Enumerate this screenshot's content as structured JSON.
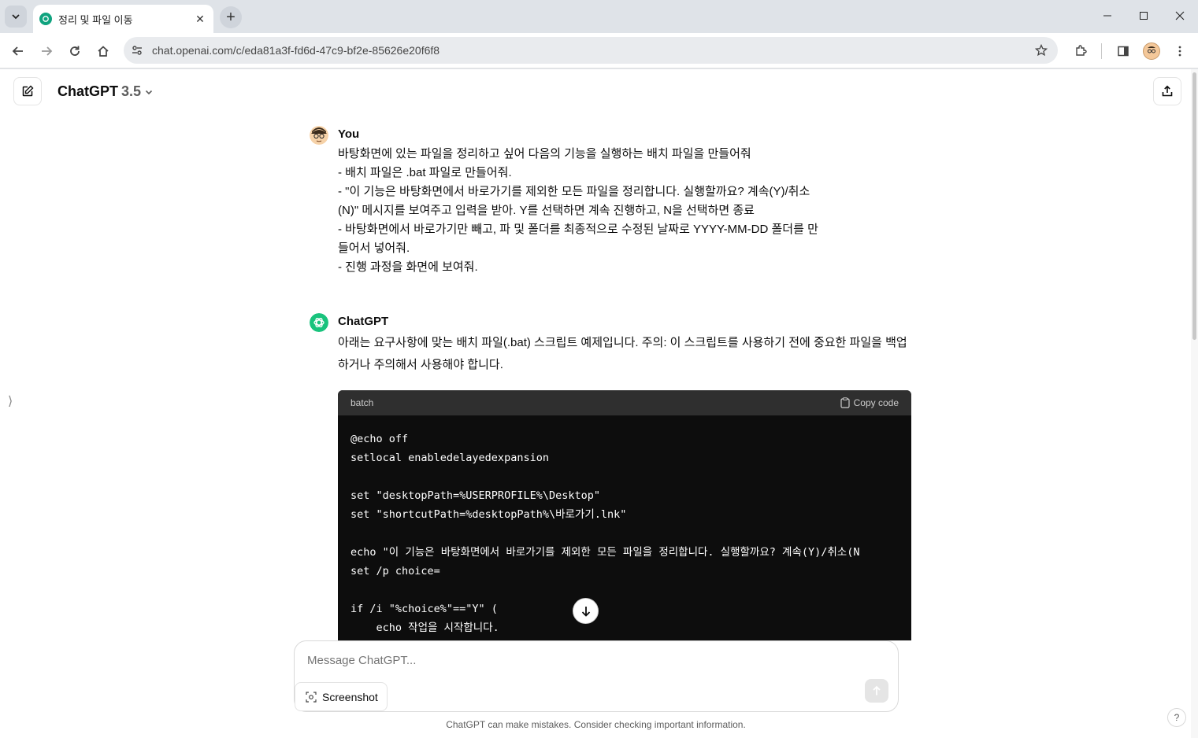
{
  "browser": {
    "tab_title": "정리 및 파일 이동",
    "url": "chat.openai.com/c/eda81a3f-fd6d-47c9-bf2e-85626e20f6f8"
  },
  "header": {
    "model_name": "ChatGPT",
    "model_version": "3.5"
  },
  "conversation": {
    "user": {
      "author": "You",
      "lines": [
        "바탕화면에  있는 파일을 정리하고 싶어 다음의 기능을 실행하는 배치 파일을  만들어줘",
        "- 배치 파일은 .bat 파일로 만들어줘.",
        "- \"이 기능은 바탕화면에서 바로가기를 제외한 모든 파일을 정리합니다. 실행할까요? 계속(Y)/취소",
        "(N)\" 메시지를 보여주고 입력을 받아. Y를 선택하면 계속 진행하고, N을 선택하면 종료",
        "- 바탕화면에서 바로가기만 빼고, 파 및 폴더를 최종적으로 수정된 날짜로 YYYY-MM-DD 폴더를 만",
        "들어서 넣어줘.",
        "- 진행 과정을 화면에 보여줘."
      ]
    },
    "assistant": {
      "author": "ChatGPT",
      "intro": "아래는 요구사항에 맞는 배치 파일(.bat) 스크립트 예제입니다. 주의: 이 스크립트를 사용하기 전에 중요한 파일을 백업하거나 주의해서 사용해야 합니다.",
      "code_lang": "batch",
      "copy_label": "Copy code",
      "code": "@echo off\nsetlocal enabledelayedexpansion\n\nset \"desktopPath=%USERPROFILE%\\Desktop\"\nset \"shortcutPath=%desktopPath%\\바로가기.lnk\"\n\necho \"이 기능은 바탕화면에서 바로가기를 제외한 모든 파일을 정리합니다. 실행할까요? 계속(Y)/취소(N\nset /p choice=\n\nif /i \"%choice%\"==\"Y\" (\n    echo 작업을 시작합니다."
    }
  },
  "composer": {
    "placeholder": "Message ChatGPT...",
    "screenshot_label": "Screenshot"
  },
  "footer": {
    "disclaimer": "ChatGPT can make mistakes. Consider checking important information.",
    "help": "?"
  },
  "colors": {
    "accent": "#10a37f",
    "code_bg": "#0d0d0d",
    "code_header_bg": "#2f2f2f"
  },
  "icons": [
    "chevron-down-icon",
    "close-icon",
    "plus-icon",
    "minimize-icon",
    "maximize-icon",
    "back-icon",
    "forward-icon",
    "reload-icon",
    "home-icon",
    "site-info-icon",
    "star-icon",
    "extensions-icon",
    "sidepanel-icon",
    "kebab-menu-icon",
    "new-chat-icon",
    "share-icon",
    "clipboard-icon",
    "arrow-down-icon",
    "arrow-up-icon",
    "camera-icon"
  ]
}
